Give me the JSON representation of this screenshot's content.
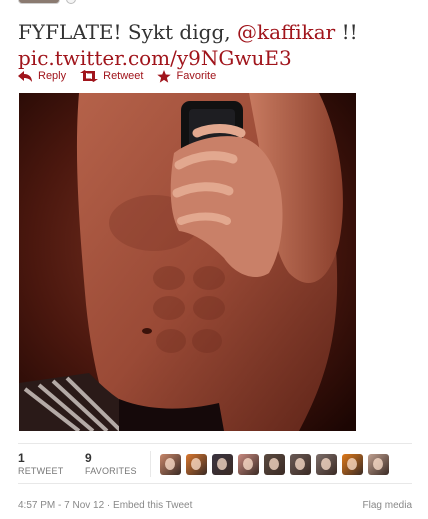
{
  "tweet": {
    "text_prefix": "FYFLATE! Sykt digg, ",
    "mention": "@kaffikar",
    "text_suffix": " !!",
    "pic_link": "pic.twitter.com/y9NGwuE3"
  },
  "actions": {
    "reply": "Reply",
    "retweet": "Retweet",
    "favorite": "Favorite"
  },
  "stats": {
    "retweets": {
      "count": "1",
      "label": "RETWEET"
    },
    "favorites": {
      "count": "9",
      "label": "FAVORITES"
    }
  },
  "favoriters": [
    {
      "icon": "favoriter-avatar",
      "color": "#c8876a"
    },
    {
      "icon": "favoriter-avatar",
      "color": "#d9772f"
    },
    {
      "icon": "favoriter-avatar",
      "color": "#3a3440"
    },
    {
      "icon": "favoriter-avatar",
      "color": "#c98a80"
    },
    {
      "icon": "favoriter-avatar",
      "color": "#5a4a40"
    },
    {
      "icon": "favoriter-avatar",
      "color": "#6a5a55"
    },
    {
      "icon": "favoriter-avatar",
      "color": "#7d6e6a"
    },
    {
      "icon": "favoriter-avatar",
      "color": "#e07a1a"
    },
    {
      "icon": "favoriter-avatar",
      "color": "#c0a090"
    }
  ],
  "footer": {
    "timestamp": "4:57 PM - 7 Nov 12",
    "separator": " · ",
    "embed": "Embed this Tweet",
    "flag": "Flag media"
  },
  "colors": {
    "link": "#a0141b",
    "text": "#333333",
    "muted": "#888888"
  }
}
